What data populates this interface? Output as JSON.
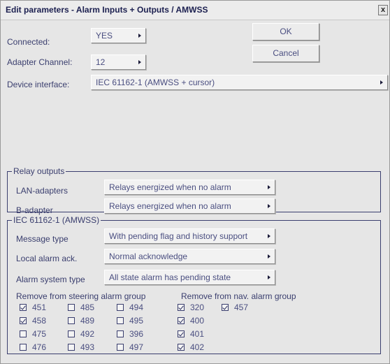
{
  "window": {
    "title": "Edit parameters - Alarm Inputs + Outputs / AMWSS",
    "close_label": "x"
  },
  "top": {
    "connected_label": "Connected:",
    "connected_value": "YES",
    "adapter_channel_label": "Adapter Channel:",
    "adapter_channel_value": "12",
    "device_interface_label": "Device interface:",
    "device_interface_value": "IEC 61162-1 (AMWSS + cursor)",
    "ok_label": "OK",
    "cancel_label": "Cancel"
  },
  "relay": {
    "legend": "Relay outputs",
    "lan_label": "LAN-adapters",
    "lan_value": "Relays energized when no alarm",
    "b_label": "B-adapter",
    "b_value": "Relays energized when no alarm"
  },
  "iec": {
    "legend": "IEC 61162-1 (AMWSS)",
    "message_type_label": "Message type",
    "message_type_value": "With pending flag and history support",
    "local_ack_label": "Local alarm ack.",
    "local_ack_value": "Normal acknowledge",
    "alarm_system_label": "Alarm system type",
    "alarm_system_value": "All state alarm has pending state",
    "steering_group_label": "Remove from steering alarm group",
    "nav_group_label": "Remove from nav. alarm group",
    "steering_items": [
      {
        "label": "451",
        "checked": true
      },
      {
        "label": "458",
        "checked": true
      },
      {
        "label": "475",
        "checked": false
      },
      {
        "label": "476",
        "checked": false
      },
      {
        "label": "485",
        "checked": false
      },
      {
        "label": "489",
        "checked": false
      },
      {
        "label": "492",
        "checked": false
      },
      {
        "label": "493",
        "checked": false
      },
      {
        "label": "494",
        "checked": false
      },
      {
        "label": "495",
        "checked": false
      },
      {
        "label": "396",
        "checked": false
      },
      {
        "label": "497",
        "checked": false
      }
    ],
    "nav_items": [
      {
        "label": "320",
        "checked": true
      },
      {
        "label": "400",
        "checked": true
      },
      {
        "label": "401",
        "checked": true
      },
      {
        "label": "402",
        "checked": true
      },
      {
        "label": "457",
        "checked": true
      }
    ]
  }
}
